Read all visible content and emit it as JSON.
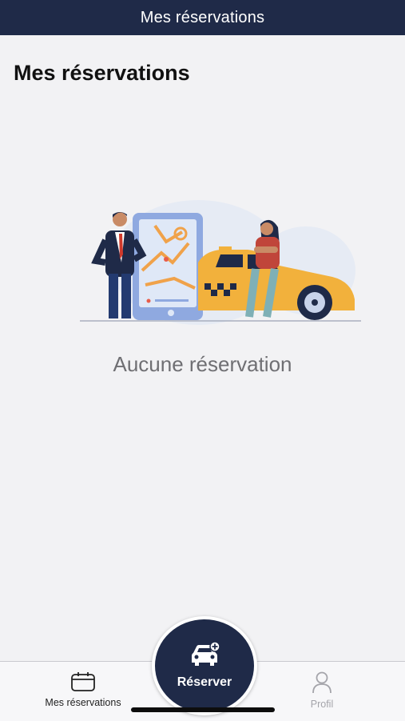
{
  "nav": {
    "title": "Mes réservations"
  },
  "page": {
    "title": "Mes réservations"
  },
  "empty_state": {
    "illustration": "taxi-booking-illustration",
    "message": "Aucune réservation"
  },
  "tabbar": {
    "items": [
      {
        "label": "Mes réservations",
        "icon": "calendar-icon",
        "active": true
      },
      {
        "label": "Réserver",
        "icon": "car-add-icon",
        "active": false
      },
      {
        "label": "Profil",
        "icon": "user-icon",
        "active": false
      }
    ]
  },
  "colors": {
    "nav_background": "#1f2a48",
    "page_background": "#f2f2f4",
    "taxi_yellow": "#f2b13c",
    "route_orange": "#f0a24a",
    "inactive_tab": "#a4a4aa"
  }
}
